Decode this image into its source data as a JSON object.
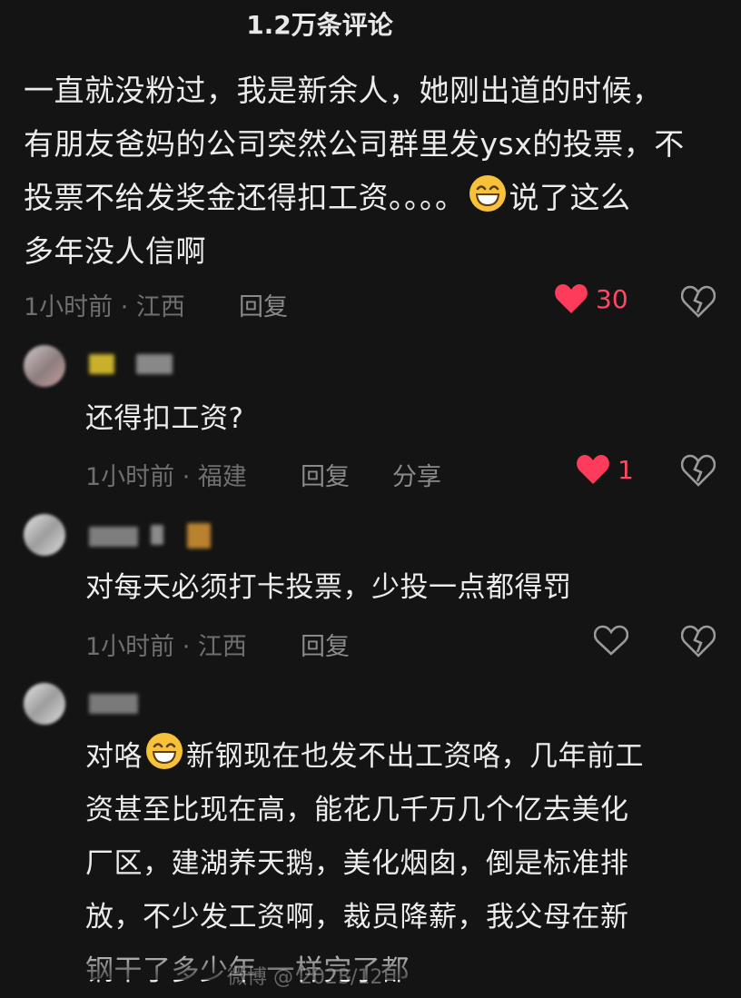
{
  "header": {
    "title": "1.2万条评论"
  },
  "comments": [
    {
      "lines": [
        "一直就没粉过，我是新余人，她刚出道的时候，",
        "有朋友爸妈的公司突然公司群里发ysx的投票，不",
        "投票不给发奖金还得扣工资。。。。",
        "说了这么",
        "多年没人信啊"
      ],
      "meta": "1小时前 · 江西",
      "reply_label": "回复",
      "likes": "30",
      "liked": true
    },
    {
      "text": "还得扣工资?",
      "meta": "1小时前 · 福建",
      "reply_label": "回复",
      "share_label": "分享",
      "likes": "1",
      "liked": true
    },
    {
      "text": "对每天必须打卡投票，少投一点都得罚",
      "meta": "1小时前 · 江西",
      "reply_label": "回复",
      "liked": false
    },
    {
      "lines": [
        "对咯",
        "新钢现在也发不出工资咯，几年前工",
        "资甚至比现在高，能花几千万几个亿去美化",
        "厂区，建湖养天鹅，美化烟囱，倒是标准排",
        "放，不少发工资啊，裁员降薪，我父母在新",
        "钢干了多少年 一样完了都"
      ]
    }
  ],
  "watermark": "微博 @ 2023/12",
  "colors": {
    "background": "#141414",
    "like": "#ff4863",
    "meta": "#6f6f6f"
  }
}
